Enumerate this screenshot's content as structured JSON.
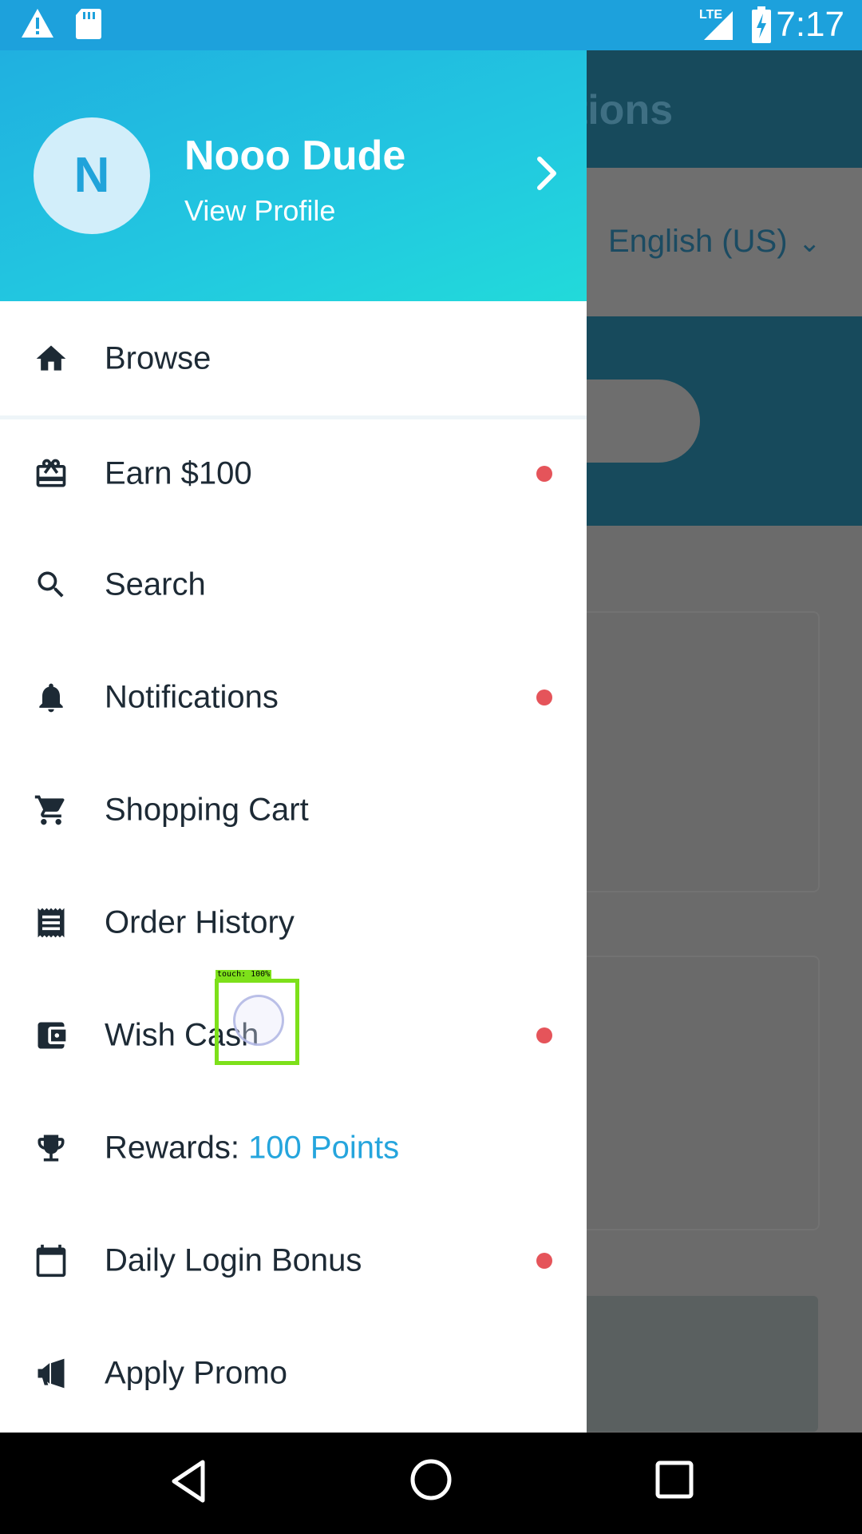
{
  "status_bar": {
    "time": "7:17",
    "network": "LTE",
    "icons": [
      "warning-icon",
      "sd-card-icon",
      "lte-signal-icon",
      "battery-charging-icon"
    ]
  },
  "background": {
    "header_title": "stions",
    "language": "English (US)"
  },
  "drawer": {
    "avatar_initial": "N",
    "profile_name": "Nooo Dude",
    "profile_link": "View Profile",
    "items": [
      {
        "label": "Browse",
        "icon": "home-icon",
        "dot": false
      },
      {
        "label": "Earn $100",
        "icon": "gift-icon",
        "dot": true
      },
      {
        "label": "Search",
        "icon": "search-icon",
        "dot": false
      },
      {
        "label": "Notifications",
        "icon": "bell-icon",
        "dot": true
      },
      {
        "label": "Shopping Cart",
        "icon": "cart-icon",
        "dot": false
      },
      {
        "label": "Order History",
        "icon": "receipt-icon",
        "dot": false
      },
      {
        "label": "Wish Cash",
        "icon": "wallet-icon",
        "dot": true
      },
      {
        "label": "Rewards: ",
        "points": "100 Points",
        "icon": "trophy-icon",
        "dot": false
      },
      {
        "label": "Daily Login Bonus",
        "icon": "calendar-icon",
        "dot": true
      },
      {
        "label": "Apply Promo",
        "icon": "megaphone-icon",
        "dot": false
      }
    ],
    "accent_color": "#25a5dd",
    "dot_color": "#e5545a"
  },
  "touch_indicator": {
    "label": "touch: 100%"
  },
  "nav_bar": {
    "icons": [
      "back-icon",
      "home-circle-icon",
      "recents-icon"
    ]
  }
}
